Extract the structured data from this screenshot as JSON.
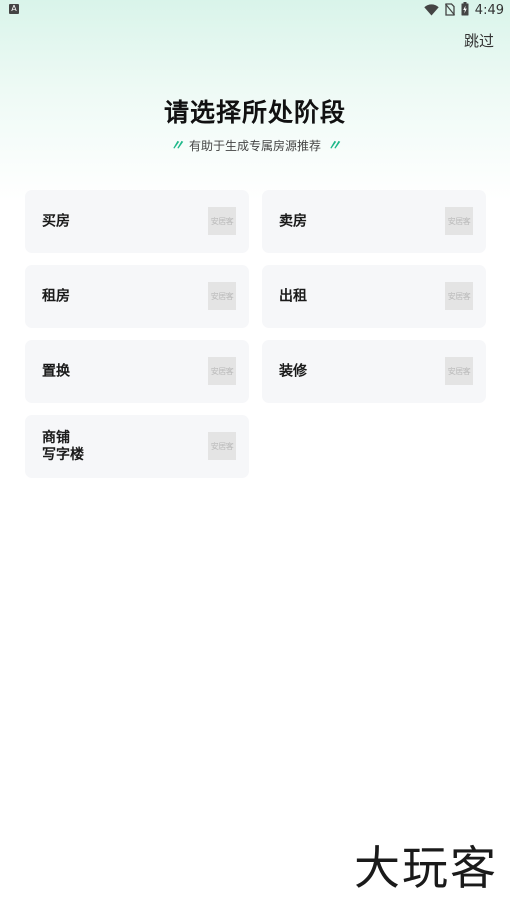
{
  "status_bar": {
    "time": "4:49",
    "left_icon": "A",
    "icons": [
      "wifi-icon",
      "no-sim-icon",
      "battery-charging-icon"
    ]
  },
  "header": {
    "skip_label": "跳过",
    "title": "请选择所处阶段",
    "subtitle": "有助于生成专属房源推荐",
    "quote_open": "〃",
    "quote_close": "〃"
  },
  "stages": [
    {
      "label_lines": [
        "买房"
      ],
      "icon": "placeholder-image-icon",
      "icon_text": "安居客"
    },
    {
      "label_lines": [
        "卖房"
      ],
      "icon": "placeholder-image-icon",
      "icon_text": "安居客"
    },
    {
      "label_lines": [
        "租房"
      ],
      "icon": "placeholder-image-icon",
      "icon_text": "安居客"
    },
    {
      "label_lines": [
        "出租"
      ],
      "icon": "placeholder-image-icon",
      "icon_text": "安居客"
    },
    {
      "label_lines": [
        "置换"
      ],
      "icon": "placeholder-image-icon",
      "icon_text": "安居客"
    },
    {
      "label_lines": [
        "装修"
      ],
      "icon": "placeholder-image-icon",
      "icon_text": "安居客"
    },
    {
      "label_lines": [
        "商铺",
        "写字楼"
      ],
      "icon": "placeholder-image-icon",
      "icon_text": "安居客"
    }
  ],
  "watermark": "大玩客",
  "colors": {
    "accent": "#1fb88a",
    "card_bg": "#f6f7f9",
    "gradient_top": "#d9f4ea"
  }
}
